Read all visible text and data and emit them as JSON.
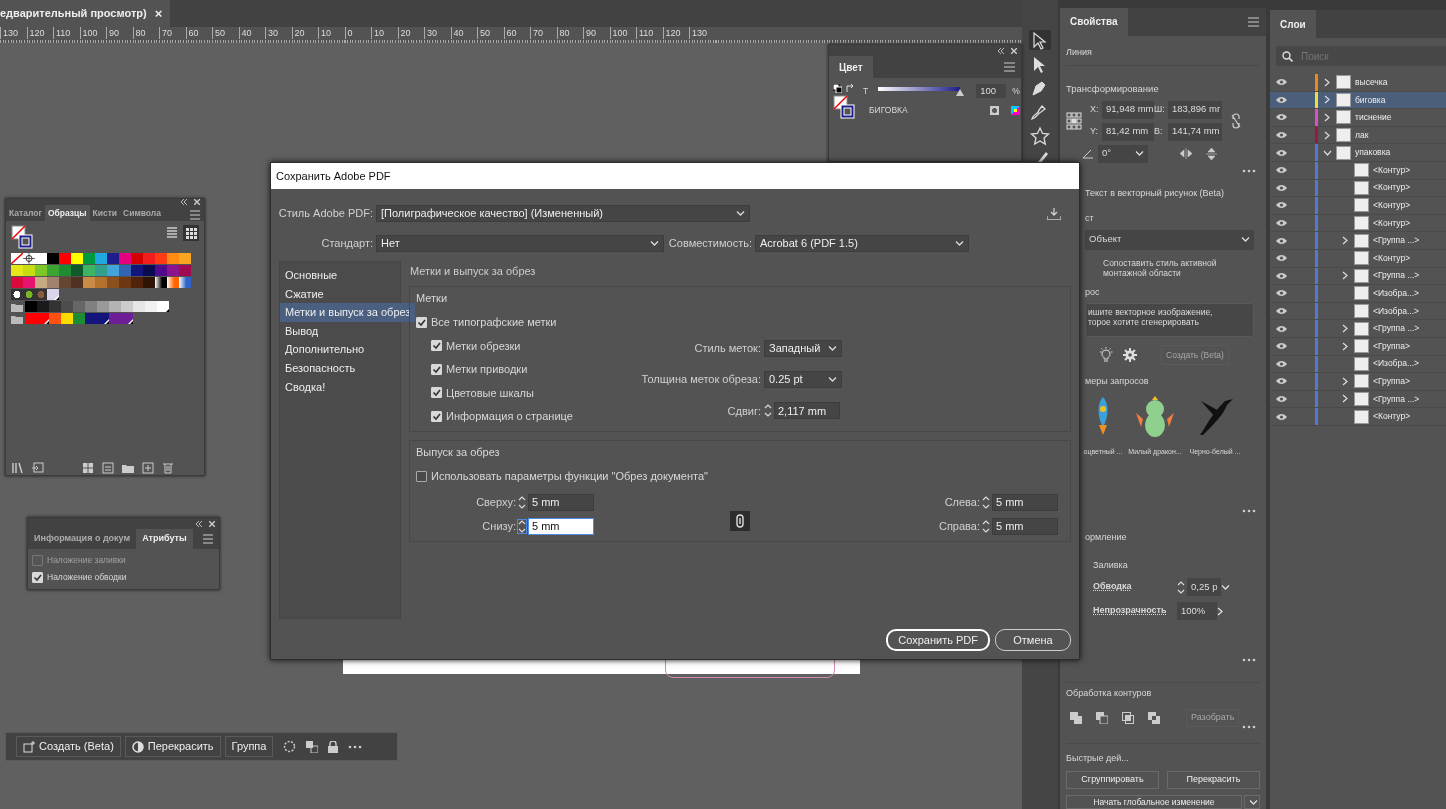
{
  "document_tab": {
    "title": "едварительный просмотр)",
    "close": "×"
  },
  "ruler": [
    "130",
    "120",
    "110",
    "100",
    "90",
    "80",
    "70",
    "60",
    "50",
    "40",
    "30",
    "20",
    "10",
    "0",
    "10",
    "20",
    "30",
    "40",
    "50",
    "60",
    "70",
    "80",
    "90",
    "100",
    "110",
    "120",
    "130"
  ],
  "color_panel": {
    "tab": "Цвет",
    "slider_label": "T",
    "level": 1,
    "value": "100",
    "unit": "%",
    "swatch_name": "БИГОВКА"
  },
  "swatches_panel": {
    "tabs": [
      {
        "label": "Каталог",
        "selected": false
      },
      {
        "label": "Образцы",
        "selected": true
      },
      {
        "label": "Кисти",
        "selected": false
      },
      {
        "label": "Символа",
        "selected": false
      }
    ],
    "rows": [
      [
        {
          "kind": "none"
        },
        {
          "kind": "registration"
        },
        {
          "kind": "solid",
          "color": "#ffffff"
        },
        {
          "kind": "solid",
          "color": "#000000"
        },
        {
          "kind": "solid",
          "color": "#ff0000"
        },
        {
          "kind": "solid",
          "color": "#ffff00"
        },
        {
          "kind": "solid",
          "color": "#009a3e"
        },
        {
          "kind": "solid",
          "color": "#1fa9e0"
        },
        {
          "kind": "solid",
          "color": "#1d1d8c"
        },
        {
          "kind": "solid",
          "color": "#e5007e"
        },
        {
          "kind": "solid",
          "color": "#d40000"
        },
        {
          "kind": "solid",
          "color": "#f21d1d"
        },
        {
          "kind": "solid",
          "color": "#ff3c14"
        },
        {
          "kind": "solid",
          "color": "#ff8a14"
        },
        {
          "kind": "solid",
          "color": "#f7a51e"
        }
      ],
      [
        {
          "kind": "solid",
          "color": "#e6e619"
        },
        {
          "kind": "solid",
          "color": "#c8dc14"
        },
        {
          "kind": "solid",
          "color": "#7dc828"
        },
        {
          "kind": "solid",
          "color": "#3ca532"
        },
        {
          "kind": "solid",
          "color": "#1e8c32"
        },
        {
          "kind": "solid",
          "color": "#0f5a28"
        },
        {
          "kind": "solid",
          "color": "#3cb464"
        },
        {
          "kind": "solid",
          "color": "#32a08c"
        },
        {
          "kind": "solid",
          "color": "#41a5dc"
        },
        {
          "kind": "solid",
          "color": "#3264b4"
        },
        {
          "kind": "solid",
          "color": "#14147d"
        },
        {
          "kind": "solid",
          "color": "#0a0a50"
        },
        {
          "kind": "solid",
          "color": "#500a8c"
        },
        {
          "kind": "solid",
          "color": "#8c148c"
        },
        {
          "kind": "solid",
          "color": "#a00a50"
        }
      ],
      [
        {
          "kind": "solid",
          "color": "#dc0a3c"
        },
        {
          "kind": "solid",
          "color": "#e6146e"
        },
        {
          "kind": "solid",
          "color": "#c8aa82"
        },
        {
          "kind": "solid",
          "color": "#a0826e"
        },
        {
          "kind": "solid",
          "color": "#644632"
        },
        {
          "kind": "solid",
          "color": "#503222"
        },
        {
          "kind": "solid",
          "color": "#c88c46"
        },
        {
          "kind": "solid",
          "color": "#b4732d"
        },
        {
          "kind": "solid",
          "color": "#8c501e"
        },
        {
          "kind": "solid",
          "color": "#6e3714"
        },
        {
          "kind": "solid",
          "color": "#50230a"
        },
        {
          "kind": "solid",
          "color": "#2d1405"
        },
        {
          "kind": "gradient",
          "color": "#000000"
        },
        {
          "kind": "gradient",
          "color": "#ff6400"
        },
        {
          "kind": "gradient",
          "color": "#3264c8"
        }
      ],
      [
        {
          "kind": "pattern",
          "color": "#ffffff"
        },
        {
          "kind": "pattern",
          "color": "#78b428"
        },
        {
          "kind": "pattern",
          "color": "#8c5a3c"
        },
        {
          "kind": "global",
          "color": "#dcd4ec"
        }
      ],
      [
        {
          "kind": "folder"
        },
        {
          "kind": "solid",
          "color": "#000000"
        },
        {
          "kind": "solid",
          "color": "#1a1a1a"
        },
        {
          "kind": "solid",
          "color": "#333333"
        },
        {
          "kind": "solid",
          "color": "#4d4d4d"
        },
        {
          "kind": "solid",
          "color": "#666666"
        },
        {
          "kind": "solid",
          "color": "#808080"
        },
        {
          "kind": "solid",
          "color": "#999999"
        },
        {
          "kind": "solid",
          "color": "#b3b3b3"
        },
        {
          "kind": "solid",
          "color": "#cccccc"
        },
        {
          "kind": "solid",
          "color": "#e6e6e6"
        },
        {
          "kind": "solid",
          "color": "#f2f2f2"
        },
        {
          "kind": "global",
          "color": "#ffffff"
        }
      ],
      [
        {
          "kind": "folder"
        },
        {
          "kind": "solid",
          "color": "#ff0000"
        },
        {
          "kind": "global",
          "color": "#ff0000"
        },
        {
          "kind": "solid",
          "color": "#ff5014"
        },
        {
          "kind": "solid",
          "color": "#ffdc00"
        },
        {
          "kind": "solid",
          "color": "#1e8c32"
        },
        {
          "kind": "solid",
          "color": "#14147d"
        },
        {
          "kind": "global",
          "color": "#14147d"
        },
        {
          "kind": "solid",
          "color": "#6e1e96"
        },
        {
          "kind": "global",
          "color": "#6e1e96"
        }
      ]
    ]
  },
  "attributes_panel": {
    "tabs": [
      {
        "label": "Информация о докум",
        "selected": false
      },
      {
        "label": "Атрибуты",
        "selected": true
      }
    ],
    "options": [
      {
        "label": "Наложение заливки",
        "checked": false,
        "disabled": true
      },
      {
        "label": "Наложение обводки",
        "checked": true,
        "disabled": false
      }
    ]
  },
  "context_toolbar": {
    "buttons": [
      {
        "label": "Создать (Beta)",
        "kind": "generate"
      },
      {
        "label": "Перекрасить",
        "kind": "recolor"
      },
      {
        "label": "Группа",
        "kind": "plain"
      }
    ]
  },
  "dialog": {
    "title": "Сохранить Adobe PDF",
    "style_label": "Стиль Adobe PDF:",
    "style_value": "[Полиграфическое качество] (Измененный)",
    "standard_label": "Стандарт:",
    "standard_value": "Нет",
    "compat_label": "Совместимость:",
    "compat_value": "Acrobat 6 (PDF 1.5)",
    "nav": [
      {
        "label": "Основные",
        "selected": false
      },
      {
        "label": "Сжатие",
        "selected": false
      },
      {
        "label": "Метки и выпуск за обрез",
        "selected": true
      },
      {
        "label": "Вывод",
        "selected": false
      },
      {
        "label": "Дополнительно",
        "selected": false
      },
      {
        "label": "Безопасность",
        "selected": false
      },
      {
        "label": "Сводка!",
        "selected": false
      }
    ],
    "section_title": "Метки и выпуск за обрез",
    "marks": {
      "title": "Метки",
      "all": {
        "label": "Все типографские метки",
        "checked": true
      },
      "items": [
        {
          "label": "Метки обрезки",
          "checked": true
        },
        {
          "label": "Метки приводки",
          "checked": true
        },
        {
          "label": "Цветовые шкалы",
          "checked": true
        },
        {
          "label": "Информация о странице",
          "checked": true
        }
      ],
      "style_label": "Стиль меток:",
      "style_value": "Западный",
      "weight_label": "Толщина меток обреза:",
      "weight_value": "0.25 pt",
      "offset_label": "Сдвиг:",
      "offset_value": "2,117 mm"
    },
    "bleed": {
      "title": "Выпуск за обрез",
      "use_doc": {
        "label": "Использовать параметры функции \"Обрез документа\"",
        "checked": false
      },
      "rows": [
        {
          "left": {
            "label": "Сверху:",
            "value": "5 mm",
            "focused": false
          },
          "right": {
            "label": "Слева:",
            "value": "5 mm",
            "focused": false
          }
        },
        {
          "left": {
            "label": "Снизу:",
            "value": "5 mm",
            "focused": true
          },
          "right": {
            "label": "Справа:",
            "value": "5 mm",
            "focused": false
          }
        }
      ]
    },
    "buttons": [
      {
        "label": "Сохранить PDF",
        "kind": "primary"
      },
      {
        "label": "Отмена",
        "kind": "secondary"
      }
    ]
  },
  "properties": {
    "tab": "Свойства",
    "object_type": "Линия",
    "transform": {
      "title": "Трансформирование",
      "fields": [
        {
          "label": "X:",
          "value": "91,948 mm"
        },
        {
          "label": "Ш:",
          "value": "183,896 mr"
        },
        {
          "label": "Y:",
          "value": "81,42 mm"
        },
        {
          "label": "В:",
          "value": "141,74 mm"
        }
      ],
      "angle": "0°"
    },
    "text_to_vector": {
      "title": "Текст в векторный рисунок (Beta)",
      "type_label": "ст",
      "type_value": "Объект",
      "match_style": "Сопоставить стиль активной монтажной области",
      "prompt_label": "рос",
      "prompt_lines": [
        "ишите векторное изображение,",
        "торое хотите сгенерировать"
      ],
      "create_button": "Создать (Beta)",
      "examples_label": "меры запросов",
      "examples": [
        {
          "caption": "оцветный ..."
        },
        {
          "caption": "Милый дракон..."
        },
        {
          "caption": "Черно-белый ..."
        }
      ]
    },
    "appearance": {
      "title": "ормление",
      "fill_label": "Заливка",
      "stroke_label": "Обводка",
      "stroke_value": "0,25 p",
      "opacity_label": "Непрозрачность",
      "opacity_value": "100%"
    },
    "pathfinder": {
      "title": "Обработка контуров",
      "expand_button": "Разобрать"
    },
    "quick_actions": {
      "title": "Быстрые дей...",
      "buttons": [
        "Сгруппировать",
        "Перекрасить"
      ],
      "global_edit": "Начать глобальное изменение"
    }
  },
  "layers": {
    "tab": "Слои",
    "search_placeholder": "Поиск",
    "items": [
      {
        "name": "высечка",
        "color": "#e8891c",
        "expanded": false,
        "selected": false
      },
      {
        "name": "биговка",
        "color": "#e8e040",
        "expanded": false,
        "selected": true
      },
      {
        "name": "тиснение",
        "color": "#d94fd0",
        "expanded": false,
        "selected": false
      },
      {
        "name": "лак",
        "color": "#a0163c",
        "expanded": false,
        "selected": false
      },
      {
        "name": "упаковка",
        "color": "#4f78d8",
        "expanded": true,
        "selected": false,
        "children": [
          {
            "name": "<Контур>",
            "selected": false
          },
          {
            "name": "<Контур>",
            "selected": false
          },
          {
            "name": "<Контур>",
            "selected": false
          },
          {
            "name": "<Контур>",
            "selected": false
          },
          {
            "name": "<Группа ...>",
            "expanded": false,
            "selected": false
          },
          {
            "name": "<Контур>",
            "selected": false
          },
          {
            "name": "<Группа ...>",
            "expanded": false,
            "selected": false
          },
          {
            "name": "<Изобра...>",
            "selected": false
          },
          {
            "name": "<Изобра...>",
            "selected": false
          },
          {
            "name": "<Группа ...>",
            "expanded": false,
            "selected": false
          },
          {
            "name": "<Группа>",
            "expanded": false,
            "selected": false
          },
          {
            "name": "<Изобра...>",
            "selected": false
          },
          {
            "name": "<Группа>",
            "expanded": false,
            "selected": false
          },
          {
            "name": "<Группа ...>",
            "expanded": false,
            "selected": false
          },
          {
            "name": "<Контур>",
            "selected": false
          }
        ]
      }
    ]
  }
}
